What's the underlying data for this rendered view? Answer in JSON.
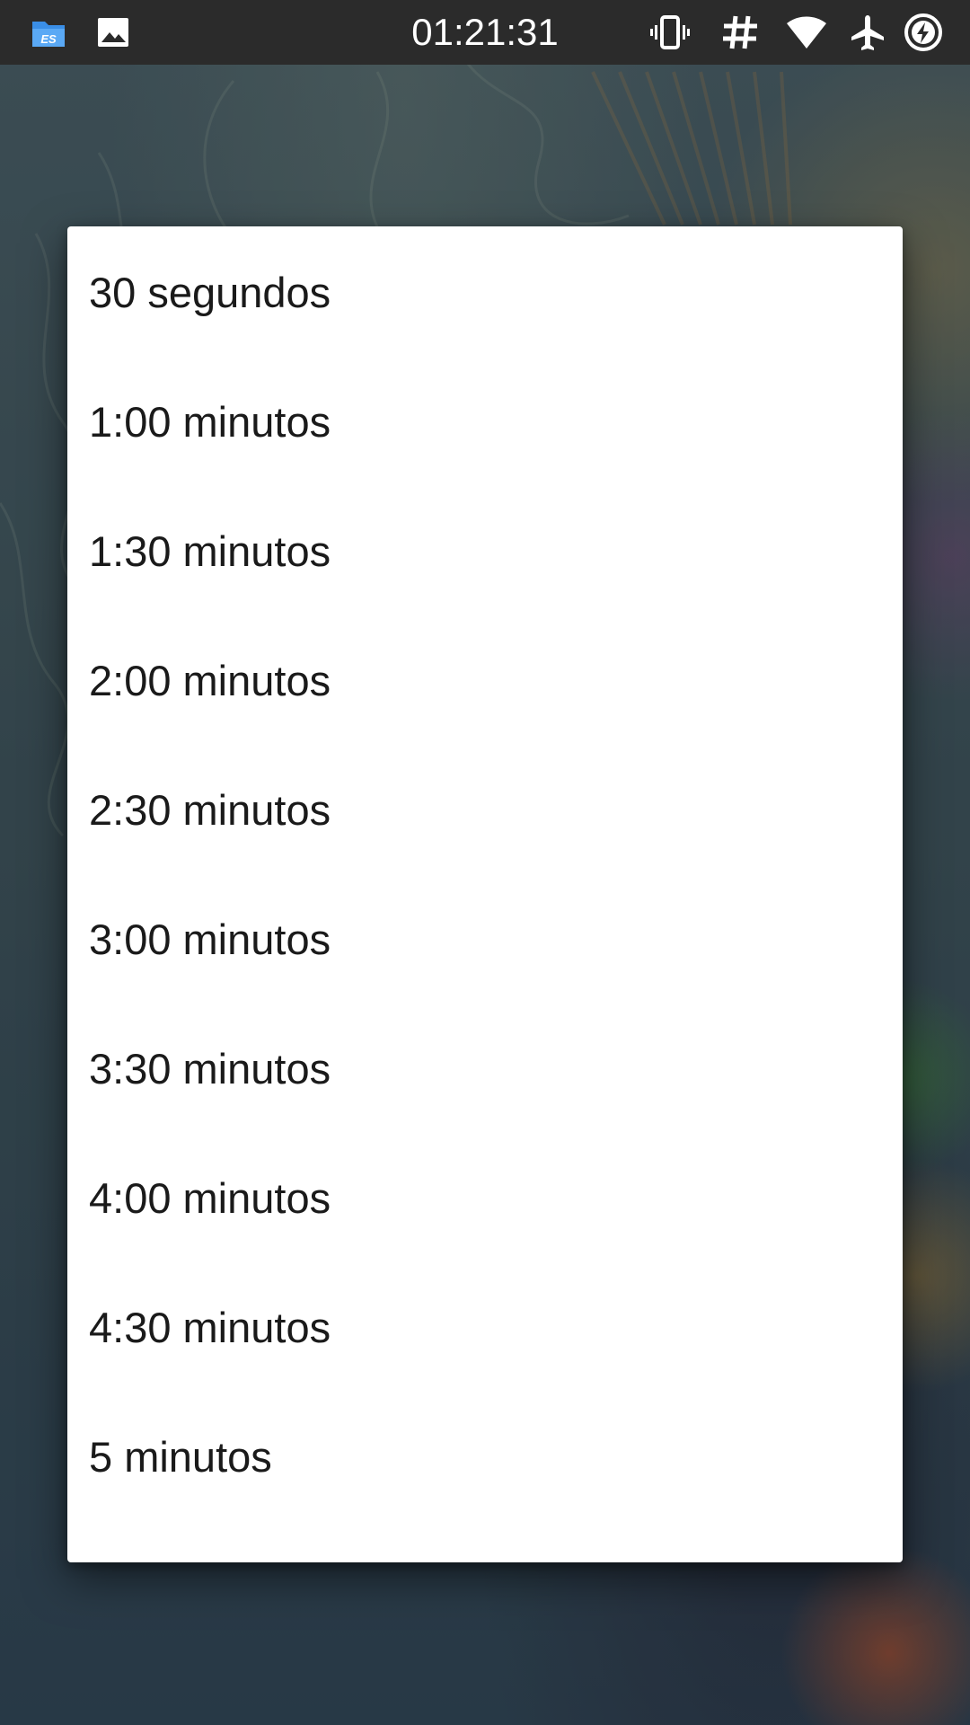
{
  "status_bar": {
    "time": "01:21:31",
    "left_icons": [
      "es-file-explorer-icon",
      "image-icon"
    ],
    "right_icons": [
      "vibrate-icon",
      "hash-icon",
      "wifi-icon",
      "airplane-mode-icon",
      "battery-charging-icon"
    ]
  },
  "dialog": {
    "options": [
      {
        "label": "30 segundos"
      },
      {
        "label": "1:00 minutos"
      },
      {
        "label": "1:30 minutos"
      },
      {
        "label": "2:00 minutos"
      },
      {
        "label": "2:30 minutos"
      },
      {
        "label": "3:00 minutos"
      },
      {
        "label": "3:30 minutos"
      },
      {
        "label": "4:00 minutos"
      },
      {
        "label": "4:30 minutos"
      },
      {
        "label": "5 minutos"
      }
    ]
  },
  "colors": {
    "status_bar_bg": "#2b2b2b",
    "dialog_bg": "#ffffff",
    "option_text": "#1a1a1a",
    "wallpaper_base": "#41575f"
  }
}
